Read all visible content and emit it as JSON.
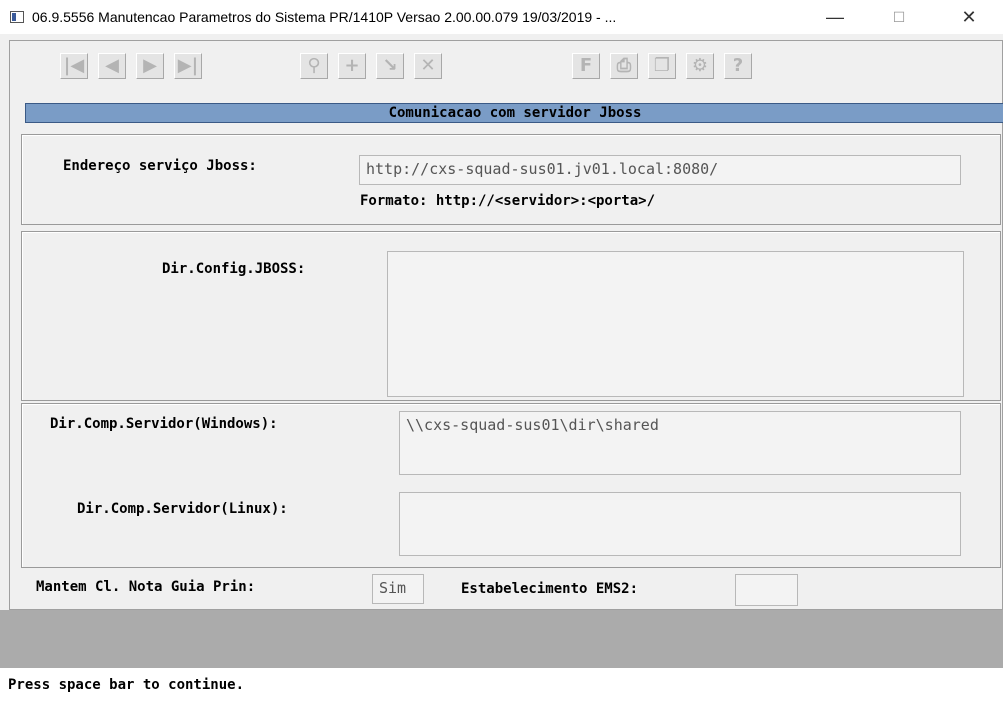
{
  "window": {
    "title": "06.9.5556 Manutencao  Parametros do Sistema PR/1410P Versao 2.00.00.079 19/03/2019 - ...",
    "minimize_glyph": "—",
    "maximize_glyph": "☐",
    "close_glyph": "✕"
  },
  "toolbar": {
    "first_icon": "skip-first-icon",
    "prev_icon": "prev-icon",
    "next_icon": "next-icon",
    "last_icon": "skip-last-icon",
    "search_icon": "key-search-icon",
    "add_icon": "plus-icon",
    "edit_icon": "arrow-edit-icon",
    "delete_icon": "x-delete-icon",
    "filter_icon": "f-icon",
    "print_icon": "printer-icon",
    "copy_icon": "documents-icon",
    "hierarchy_icon": "tree-icon",
    "help_icon": "help-icon"
  },
  "section": {
    "title": "Comunicacao com servidor Jboss"
  },
  "jboss": {
    "endereco_label": "Endereço serviço Jboss:",
    "endereco_value": "http://cxs-squad-sus01.jv01.local:8080/",
    "formato_text": "Formato: http://<servidor>:<porta>/"
  },
  "config": {
    "dir_config_label": "Dir.Config.JBOSS:",
    "dir_config_value": ""
  },
  "servidor": {
    "windows_label": "Dir.Comp.Servidor(Windows):",
    "windows_value": "\\\\cxs-squad-sus01\\dir\\shared",
    "linux_label": "Dir.Comp.Servidor(Linux):",
    "linux_value": ""
  },
  "bottom": {
    "mantem_label": "Mantem Cl. Nota Guia Prin:",
    "mantem_value": "Sim",
    "estab_label": "Estabelecimento EMS2:",
    "estab_value": ""
  },
  "status": {
    "message": "Press space bar to continue."
  }
}
